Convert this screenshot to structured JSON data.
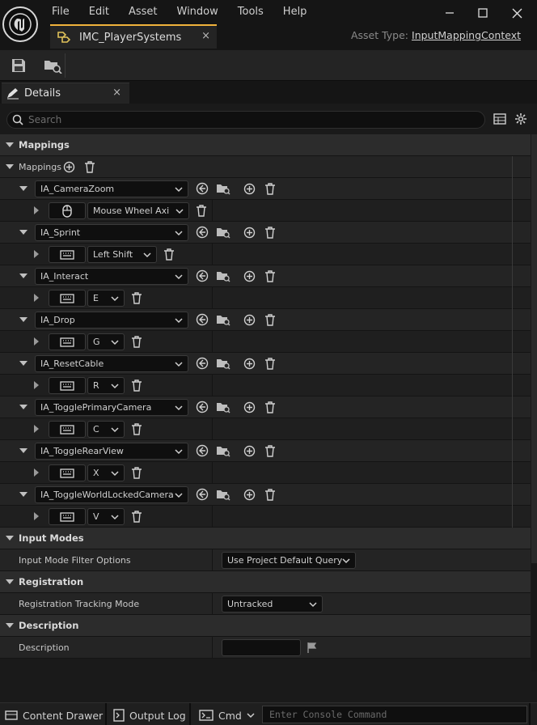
{
  "menu": [
    "File",
    "Edit",
    "Asset",
    "Window",
    "Tools",
    "Help"
  ],
  "tab": {
    "title": "IMC_PlayerSystems",
    "close": "×"
  },
  "asset_type": {
    "label": "Asset Type:",
    "value": "InputMappingContext"
  },
  "details_tab": {
    "title": "Details",
    "close": "×"
  },
  "search": {
    "placeholder": "Search"
  },
  "sections": {
    "mappings": "Mappings",
    "mappings_array": "Mappings",
    "input_modes": "Input Modes",
    "registration": "Registration",
    "description": "Description"
  },
  "mapping_entries": [
    {
      "action": "IA_CameraZoom",
      "key": "Mouse Wheel Axi",
      "device": "mouse"
    },
    {
      "action": "IA_Sprint",
      "key": "Left Shift",
      "device": "keyboard"
    },
    {
      "action": "IA_Interact",
      "key": "E",
      "device": "keyboard"
    },
    {
      "action": "IA_Drop",
      "key": "G",
      "device": "keyboard"
    },
    {
      "action": "IA_ResetCable",
      "key": "R",
      "device": "keyboard"
    },
    {
      "action": "IA_TogglePrimaryCamera",
      "key": "C",
      "device": "keyboard"
    },
    {
      "action": "IA_ToggleRearView",
      "key": "X",
      "device": "keyboard"
    },
    {
      "action": "IA_ToggleWorldLockedCamera",
      "key": "V",
      "device": "keyboard"
    }
  ],
  "properties": {
    "input_mode_filter": {
      "label": "Input Mode Filter Options",
      "value": "Use Project Default Query"
    },
    "registration_tracking": {
      "label": "Registration Tracking Mode",
      "value": "Untracked"
    },
    "description": {
      "label": "Description",
      "value": ""
    }
  },
  "statusbar": {
    "content_drawer": "Content Drawer",
    "output_log": "Output Log",
    "cmd": "Cmd",
    "console_placeholder": "Enter Console Command"
  },
  "colors": {
    "accent": "#f0b23b",
    "background": "#1a1a1a",
    "category": "#2c2c2c",
    "row": "#242424"
  }
}
